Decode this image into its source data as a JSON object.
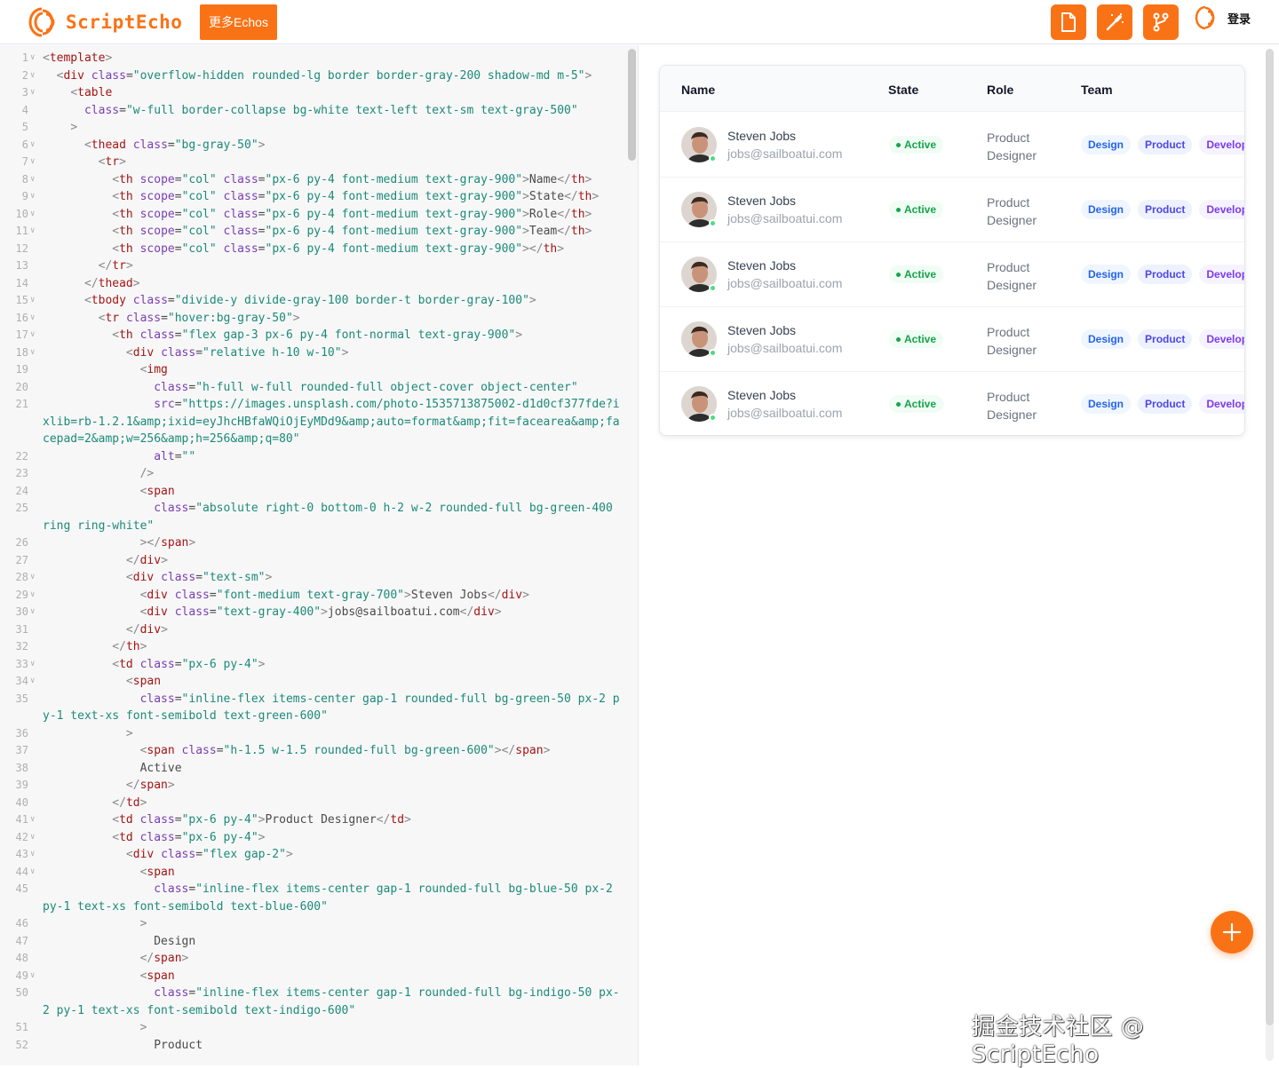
{
  "header": {
    "logo_text": "ScriptEcho",
    "more_echos_label": "更多Echos",
    "login_label": "登录",
    "icons": [
      "file-icon",
      "magic-wand-icon",
      "branch-icon",
      "scriptecho-logo-icon"
    ]
  },
  "code_editor": {
    "lines": [
      {
        "n": "1",
        "fold": true,
        "html": "<span class='p'>&lt;</span><span class='t'>template</span><span class='p'>&gt;</span>"
      },
      {
        "n": "2",
        "fold": true,
        "html": "  <span class='p'>&lt;</span><span class='t'>div</span> <span class='a'>class</span>=<span class='s'>\"overflow-hidden rounded-lg border border-gray-200 shadow-md m-5\"</span><span class='p'>&gt;</span>"
      },
      {
        "n": "3",
        "fold": true,
        "html": "    <span class='p'>&lt;</span><span class='t'>table</span>"
      },
      {
        "n": "4",
        "fold": false,
        "html": "      <span class='a'>class</span>=<span class='s'>\"w-full border-collapse bg-white text-left text-sm text-gray-500\"</span>"
      },
      {
        "n": "5",
        "fold": false,
        "html": "    <span class='p'>&gt;</span>"
      },
      {
        "n": "6",
        "fold": true,
        "html": "      <span class='p'>&lt;</span><span class='t'>thead</span> <span class='a'>class</span>=<span class='s'>\"bg-gray-50\"</span><span class='p'>&gt;</span>"
      },
      {
        "n": "7",
        "fold": true,
        "html": "        <span class='p'>&lt;</span><span class='t'>tr</span><span class='p'>&gt;</span>"
      },
      {
        "n": "8",
        "fold": true,
        "html": "          <span class='p'>&lt;</span><span class='t'>th</span> <span class='a'>scope</span>=<span class='s'>\"col\"</span> <span class='a'>class</span>=<span class='s'>\"px-6 py-4 font-medium text-gray-900\"</span><span class='p'>&gt;</span>Name<span class='p'>&lt;/</span><span class='t'>th</span><span class='p'>&gt;</span>"
      },
      {
        "n": "9",
        "fold": true,
        "html": "          <span class='p'>&lt;</span><span class='t'>th</span> <span class='a'>scope</span>=<span class='s'>\"col\"</span> <span class='a'>class</span>=<span class='s'>\"px-6 py-4 font-medium text-gray-900\"</span><span class='p'>&gt;</span>State<span class='p'>&lt;/</span><span class='t'>th</span><span class='p'>&gt;</span>"
      },
      {
        "n": "10",
        "fold": true,
        "html": "          <span class='p'>&lt;</span><span class='t'>th</span> <span class='a'>scope</span>=<span class='s'>\"col\"</span> <span class='a'>class</span>=<span class='s'>\"px-6 py-4 font-medium text-gray-900\"</span><span class='p'>&gt;</span>Role<span class='p'>&lt;/</span><span class='t'>th</span><span class='p'>&gt;</span>"
      },
      {
        "n": "11",
        "fold": true,
        "html": "          <span class='p'>&lt;</span><span class='t'>th</span> <span class='a'>scope</span>=<span class='s'>\"col\"</span> <span class='a'>class</span>=<span class='s'>\"px-6 py-4 font-medium text-gray-900\"</span><span class='p'>&gt;</span>Team<span class='p'>&lt;/</span><span class='t'>th</span><span class='p'>&gt;</span>"
      },
      {
        "n": "12",
        "fold": false,
        "html": "          <span class='p'>&lt;</span><span class='t'>th</span> <span class='a'>scope</span>=<span class='s'>\"col\"</span> <span class='a'>class</span>=<span class='s'>\"px-6 py-4 font-medium text-gray-900\"</span><span class='p'>&gt;&lt;/</span><span class='t'>th</span><span class='p'>&gt;</span>"
      },
      {
        "n": "13",
        "fold": false,
        "html": "        <span class='p'>&lt;/</span><span class='t'>tr</span><span class='p'>&gt;</span>"
      },
      {
        "n": "14",
        "fold": false,
        "html": "      <span class='p'>&lt;/</span><span class='t'>thead</span><span class='p'>&gt;</span>"
      },
      {
        "n": "15",
        "fold": true,
        "html": "      <span class='p'>&lt;</span><span class='t'>tbody</span> <span class='a'>class</span>=<span class='s'>\"divide-y divide-gray-100 border-t border-gray-100\"</span><span class='p'>&gt;</span>"
      },
      {
        "n": "16",
        "fold": true,
        "html": "        <span class='p'>&lt;</span><span class='t'>tr</span> <span class='a'>class</span>=<span class='s'>\"hover:bg-gray-50\"</span><span class='p'>&gt;</span>"
      },
      {
        "n": "17",
        "fold": true,
        "html": "          <span class='p'>&lt;</span><span class='t'>th</span> <span class='a'>class</span>=<span class='s'>\"flex gap-3 px-6 py-4 font-normal text-gray-900\"</span><span class='p'>&gt;</span>"
      },
      {
        "n": "18",
        "fold": true,
        "html": "            <span class='p'>&lt;</span><span class='t'>div</span> <span class='a'>class</span>=<span class='s'>\"relative h-10 w-10\"</span><span class='p'>&gt;</span>"
      },
      {
        "n": "19",
        "fold": false,
        "html": "              <span class='p'>&lt;</span><span class='t'>img</span>"
      },
      {
        "n": "20",
        "fold": false,
        "html": "                <span class='a'>class</span>=<span class='s'>\"h-full w-full rounded-full object-cover object-center\"</span>"
      },
      {
        "n": "21",
        "fold": false,
        "html": "                <span class='a'>src</span>=<span class='s'>\"https://images.unsplash.com/photo-1535713875002-d1d0cf377fde?ixlib=rb-1.2.1&amp;amp;ixid=eyJhcHBfaWQiOjEyMDd9&amp;amp;auto=format&amp;amp;fit=facearea&amp;amp;facepad=2&amp;amp;w=256&amp;amp;h=256&amp;amp;q=80\"</span>"
      },
      {
        "n": "22",
        "fold": false,
        "html": "                <span class='a'>alt</span>=<span class='s'>\"\"</span>"
      },
      {
        "n": "23",
        "fold": false,
        "html": "              <span class='p'>/&gt;</span>"
      },
      {
        "n": "24",
        "fold": false,
        "html": "              <span class='p'>&lt;</span><span class='t'>span</span>"
      },
      {
        "n": "25",
        "fold": false,
        "html": "                <span class='a'>class</span>=<span class='s'>\"absolute right-0 bottom-0 h-2 w-2 rounded-full bg-green-400 ring ring-white\"</span>"
      },
      {
        "n": "26",
        "fold": false,
        "html": "              <span class='p'>&gt;&lt;/</span><span class='t'>span</span><span class='p'>&gt;</span>"
      },
      {
        "n": "27",
        "fold": false,
        "html": "            <span class='p'>&lt;/</span><span class='t'>div</span><span class='p'>&gt;</span>"
      },
      {
        "n": "28",
        "fold": true,
        "html": "            <span class='p'>&lt;</span><span class='t'>div</span> <span class='a'>class</span>=<span class='s'>\"text-sm\"</span><span class='p'>&gt;</span>"
      },
      {
        "n": "29",
        "fold": true,
        "html": "              <span class='p'>&lt;</span><span class='t'>div</span> <span class='a'>class</span>=<span class='s'>\"font-medium text-gray-700\"</span><span class='p'>&gt;</span>Steven Jobs<span class='p'>&lt;/</span><span class='t'>div</span><span class='p'>&gt;</span>"
      },
      {
        "n": "30",
        "fold": true,
        "html": "              <span class='p'>&lt;</span><span class='t'>div</span> <span class='a'>class</span>=<span class='s'>\"text-gray-400\"</span><span class='p'>&gt;</span>jobs@sailboatui.com<span class='p'>&lt;/</span><span class='t'>div</span><span class='p'>&gt;</span>"
      },
      {
        "n": "31",
        "fold": false,
        "html": "            <span class='p'>&lt;/</span><span class='t'>div</span><span class='p'>&gt;</span>"
      },
      {
        "n": "32",
        "fold": false,
        "html": "          <span class='p'>&lt;/</span><span class='t'>th</span><span class='p'>&gt;</span>"
      },
      {
        "n": "33",
        "fold": true,
        "html": "          <span class='p'>&lt;</span><span class='t'>td</span> <span class='a'>class</span>=<span class='s'>\"px-6 py-4\"</span><span class='p'>&gt;</span>"
      },
      {
        "n": "34",
        "fold": true,
        "html": "            <span class='p'>&lt;</span><span class='t'>span</span>"
      },
      {
        "n": "35",
        "fold": false,
        "html": "              <span class='a'>class</span>=<span class='s'>\"inline-flex items-center gap-1 rounded-full bg-green-50 px-2 py-1 text-xs font-semibold text-green-600\"</span>"
      },
      {
        "n": "36",
        "fold": false,
        "html": "            <span class='p'>&gt;</span>"
      },
      {
        "n": "37",
        "fold": false,
        "html": "              <span class='p'>&lt;</span><span class='t'>span</span> <span class='a'>class</span>=<span class='s'>\"h-1.5 w-1.5 rounded-full bg-green-600\"</span><span class='p'>&gt;&lt;/</span><span class='t'>span</span><span class='p'>&gt;</span>"
      },
      {
        "n": "38",
        "fold": false,
        "html": "              Active"
      },
      {
        "n": "39",
        "fold": false,
        "html": "            <span class='p'>&lt;/</span><span class='t'>span</span><span class='p'>&gt;</span>"
      },
      {
        "n": "40",
        "fold": false,
        "html": "          <span class='p'>&lt;/</span><span class='t'>td</span><span class='p'>&gt;</span>"
      },
      {
        "n": "41",
        "fold": true,
        "html": "          <span class='p'>&lt;</span><span class='t'>td</span> <span class='a'>class</span>=<span class='s'>\"px-6 py-4\"</span><span class='p'>&gt;</span>Product Designer<span class='p'>&lt;/</span><span class='t'>td</span><span class='p'>&gt;</span>"
      },
      {
        "n": "42",
        "fold": true,
        "html": "          <span class='p'>&lt;</span><span class='t'>td</span> <span class='a'>class</span>=<span class='s'>\"px-6 py-4\"</span><span class='p'>&gt;</span>"
      },
      {
        "n": "43",
        "fold": true,
        "html": "            <span class='p'>&lt;</span><span class='t'>div</span> <span class='a'>class</span>=<span class='s'>\"flex gap-2\"</span><span class='p'>&gt;</span>"
      },
      {
        "n": "44",
        "fold": true,
        "html": "              <span class='p'>&lt;</span><span class='t'>span</span>"
      },
      {
        "n": "45",
        "fold": false,
        "html": "                <span class='a'>class</span>=<span class='s'>\"inline-flex items-center gap-1 rounded-full bg-blue-50 px-2 py-1 text-xs font-semibold text-blue-600\"</span>"
      },
      {
        "n": "46",
        "fold": false,
        "html": "              <span class='p'>&gt;</span>"
      },
      {
        "n": "47",
        "fold": false,
        "html": "                Design"
      },
      {
        "n": "48",
        "fold": false,
        "html": "              <span class='p'>&lt;/</span><span class='t'>span</span><span class='p'>&gt;</span>"
      },
      {
        "n": "49",
        "fold": true,
        "html": "              <span class='p'>&lt;</span><span class='t'>span</span>"
      },
      {
        "n": "50",
        "fold": false,
        "html": "                <span class='a'>class</span>=<span class='s'>\"inline-flex items-center gap-1 rounded-full bg-indigo-50 px-2 py-1 text-xs font-semibold text-indigo-600\"</span>"
      },
      {
        "n": "51",
        "fold": false,
        "html": "              <span class='p'>&gt;</span>"
      },
      {
        "n": "52",
        "fold": false,
        "html": "                Product"
      }
    ]
  },
  "preview": {
    "columns": [
      "Name",
      "State",
      "Role",
      "Team"
    ],
    "rows": [
      {
        "name": "Steven Jobs",
        "email": "jobs@sailboatui.com",
        "state": "Active",
        "role": "Product Designer",
        "tags": [
          "Design",
          "Product",
          "Develop"
        ]
      },
      {
        "name": "Steven Jobs",
        "email": "jobs@sailboatui.com",
        "state": "Active",
        "role": "Product Designer",
        "tags": [
          "Design",
          "Product",
          "Develop"
        ]
      },
      {
        "name": "Steven Jobs",
        "email": "jobs@sailboatui.com",
        "state": "Active",
        "role": "Product Designer",
        "tags": [
          "Design",
          "Product",
          "Develop"
        ]
      },
      {
        "name": "Steven Jobs",
        "email": "jobs@sailboatui.com",
        "state": "Active",
        "role": "Product Designer",
        "tags": [
          "Design",
          "Product",
          "Develop"
        ]
      },
      {
        "name": "Steven Jobs",
        "email": "jobs@sailboatui.com",
        "state": "Active",
        "role": "Product Designer",
        "tags": [
          "Design",
          "Product",
          "Develop"
        ]
      }
    ],
    "fab_icon": "plus-icon"
  },
  "watermark": "掘金技术社区 @ ScriptEcho",
  "colors": {
    "accent": "#f97316",
    "active_green": "#16a34a",
    "tag_blue": "#2563eb",
    "tag_indigo": "#4f46e5",
    "tag_violet": "#7c3aed"
  }
}
